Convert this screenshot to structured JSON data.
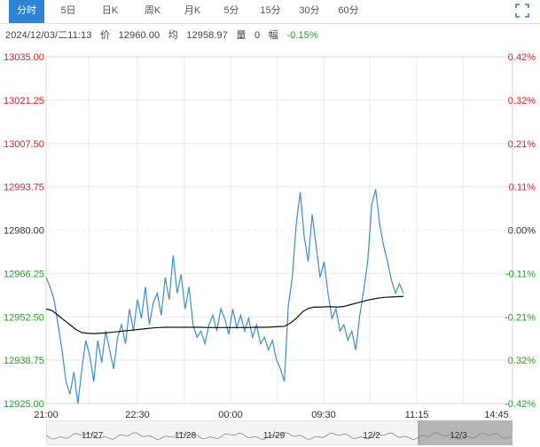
{
  "tabs": [
    {
      "label": "分时",
      "active": true
    },
    {
      "label": "5日"
    },
    {
      "label": "日K"
    },
    {
      "label": "周K"
    },
    {
      "label": "月K"
    },
    {
      "label": "5分"
    },
    {
      "label": "15分"
    },
    {
      "label": "30分"
    },
    {
      "label": "60分"
    }
  ],
  "info": {
    "datetime": "2024/12/03/二11:13",
    "price_label": "价",
    "price": "12960.00",
    "avg_label": "均",
    "avg": "12958.97",
    "volume_label": "量",
    "volume": "0",
    "change_label": "幅",
    "change": "-0.15%"
  },
  "colors": {
    "up": "#e02020",
    "down": "#1aa71a",
    "neutral": "#333333",
    "price_line": "#3d8fd1",
    "avg_line": "#111111",
    "tab_active_bg": "#2f83d4",
    "grid": "#e8e8e8"
  },
  "chart_data": {
    "type": "line",
    "y_ticks_left": [
      "13035.00",
      "13021.25",
      "13007.50",
      "12993.75",
      "12980.00",
      "12966.25",
      "12952.50",
      "12938.75",
      "12925.00"
    ],
    "y_ticks_right": [
      "0.42%",
      "0.32%",
      "0.21%",
      "0.11%",
      "0.00%",
      "-0.11%",
      "-0.21%",
      "0.32%",
      "-0.42%"
    ],
    "x_ticks": [
      "21:00",
      "22:30",
      "00:00",
      "09:30",
      "11:15",
      "14:45"
    ],
    "ylim": [
      12925.0,
      13035.0
    ],
    "prev_close": 12980.0,
    "series": [
      {
        "values": [
          12965,
          12962,
          12958,
          12950,
          12942,
          12932,
          12928,
          12935,
          12925,
          12936,
          12945,
          12940,
          12932,
          12945,
          12938,
          12948,
          12942,
          12936,
          12946,
          12950,
          12944,
          12955,
          12948,
          12958,
          12952,
          12962,
          12950,
          12957,
          12960,
          12953,
          12965,
          12958,
          12972,
          12960,
          12966,
          12955,
          12962,
          12950,
          12946,
          12948,
          12944,
          12950,
          12953,
          12948,
          12955,
          12952,
          12947,
          12955,
          12949,
          12953,
          12948,
          12952,
          12946,
          12950,
          12944,
          12946,
          12942,
          12945,
          12939,
          12936,
          12932,
          12956,
          12965,
          12982,
          12992,
          12978,
          12970,
          12985,
          12975,
          12965,
          12970,
          12960,
          12952,
          12955,
          12948,
          12950,
          12945,
          12948,
          12942,
          12953,
          12961,
          12970,
          12988,
          12993,
          12982,
          12975,
          12970,
          12964,
          12960,
          12963,
          12960
        ]
      },
      {
        "values": [
          12955,
          12954.5,
          12953,
          12951.5,
          12950,
          12948.5,
          12947.5,
          12947.3,
          12947.2,
          12947.3,
          12947.4,
          12947.6,
          12947.8,
          12948,
          12948.2,
          12948.4,
          12948.6,
          12948.8,
          12949,
          12949.1,
          12949.2,
          12949.2,
          12949.2,
          12949.2,
          12949.2,
          12949.2,
          12949.2,
          12949.1,
          12949.1,
          12949.1,
          12949.1,
          12949.1,
          12949.1,
          12949.1,
          12949.1,
          12949.2,
          12949.2,
          12949.2,
          12949.3,
          12949.4,
          12949.5,
          12950.5,
          12952,
          12954,
          12955.2,
          12955.6,
          12955.6,
          12955.7,
          12955.7,
          12955.6,
          12955.8,
          12956.3,
          12956.8,
          12957.3,
          12957.8,
          12958.2,
          12958.5,
          12958.7,
          12958.8,
          12958.9,
          12958.97
        ]
      }
    ]
  },
  "navigator": {
    "labels": [
      "11/27",
      "11/28",
      "11/29",
      "12/2",
      "12/3"
    ]
  }
}
